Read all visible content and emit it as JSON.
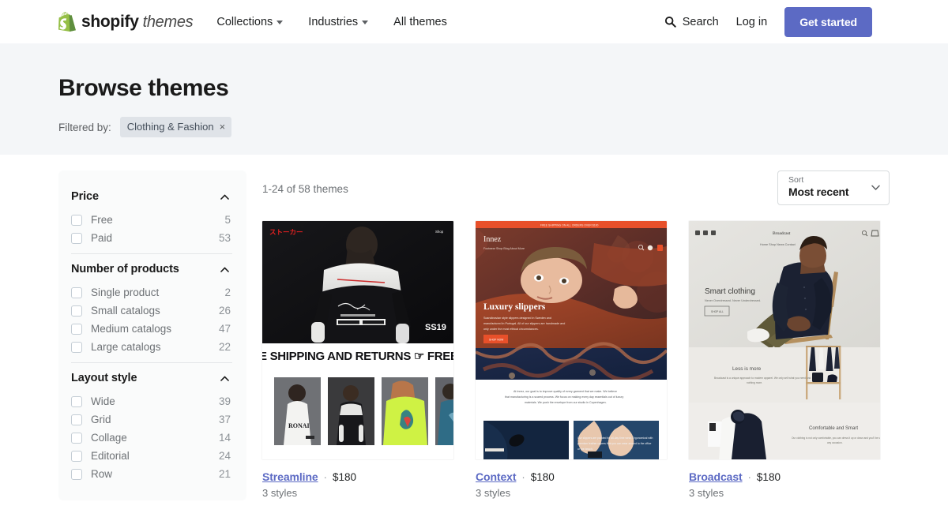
{
  "header": {
    "logo": {
      "brand": "shopify",
      "product": "themes",
      "icon": "shopify-bag-icon"
    },
    "nav": [
      {
        "label": "Collections",
        "has_caret": true
      },
      {
        "label": "Industries",
        "has_caret": true
      },
      {
        "label": "All themes",
        "has_caret": false
      }
    ],
    "search_label": "Search",
    "login_label": "Log in",
    "cta_label": "Get started",
    "cta_color": "#5c6ac4"
  },
  "hero": {
    "title": "Browse themes",
    "filtered_by_label": "Filtered by:",
    "chips": [
      {
        "label": "Clothing & Fashion",
        "remove": "×"
      }
    ]
  },
  "sidebar": {
    "facets": [
      {
        "title": "Price",
        "options": [
          {
            "label": "Free",
            "count": "5",
            "checked": false
          },
          {
            "label": "Paid",
            "count": "53",
            "checked": false
          }
        ]
      },
      {
        "title": "Number of products",
        "options": [
          {
            "label": "Single product",
            "count": "2",
            "checked": false
          },
          {
            "label": "Small catalogs",
            "count": "26",
            "checked": false
          },
          {
            "label": "Medium catalogs",
            "count": "47",
            "checked": false
          },
          {
            "label": "Large catalogs",
            "count": "22",
            "checked": false
          }
        ]
      },
      {
        "title": "Layout style",
        "options": [
          {
            "label": "Wide",
            "count": "39",
            "checked": false
          },
          {
            "label": "Grid",
            "count": "37",
            "checked": false
          },
          {
            "label": "Collage",
            "count": "14",
            "checked": false
          },
          {
            "label": "Editorial",
            "count": "24",
            "checked": false
          },
          {
            "label": "Row",
            "count": "21",
            "checked": false
          }
        ]
      }
    ]
  },
  "results": {
    "count_text": "1-24 of 58 themes",
    "sort": {
      "label": "Sort",
      "value": "Most recent"
    },
    "cards": [
      {
        "name": "Streamline",
        "separator": "·",
        "price": "$180",
        "styles": "3 styles",
        "preview": {
          "store_logo": "ストーカー",
          "nav": "Shop",
          "season": "SS19",
          "marquee": "E SHIPPING AND RETURNS ☞ FREE SH"
        }
      },
      {
        "name": "Context",
        "separator": "·",
        "price": "$180",
        "styles": "3 styles",
        "preview": {
          "announcement": "FREE SHIPPING ON ALL ORDERS OVER $100",
          "store_logo": "Innez",
          "nav": [
            "Footwear",
            "Shop",
            "Blog",
            "About",
            "More"
          ],
          "headline": "Luxury slippers",
          "body": "Scandinavian style slippers designed in Sweden and manufactured in Portugal. All of our slippers are handmade and only under the most ethical circumstances.",
          "button": "SHOP NOW",
          "section_text": "At Innez, our goal is to improve quality of every garment that we make. We believe that manufacturing is a scared process. We focus on making every day essentials out of luxury materials. We push the envelope from our studio in Copenhagen.",
          "tile_text": "Our slippers are padded for all-day time wear. Ergonomical with premium leather uppers that you can wear around to the office or the beach."
        }
      },
      {
        "name": "Broadcast",
        "separator": "·",
        "price": "$180",
        "styles": "3 styles",
        "preview": {
          "store_logo": "Broadcast",
          "nav": [
            "Home",
            "Shop",
            "News",
            "Contact"
          ],
          "headline": "Smart clothing",
          "subhead": "Never Overdressed. Never Underdressed.",
          "button": "SHOP ALL",
          "section1_title": "Less is more",
          "section1_body": "Broadcast is a unique approach to modern apparel. We only sell what you need and nothing more.",
          "section2_title": "Comfortable and Smart",
          "section2_body": "Our clothing is not only comfortable, you can dress it up or down and you'll be set for any occasion."
        }
      }
    ]
  }
}
